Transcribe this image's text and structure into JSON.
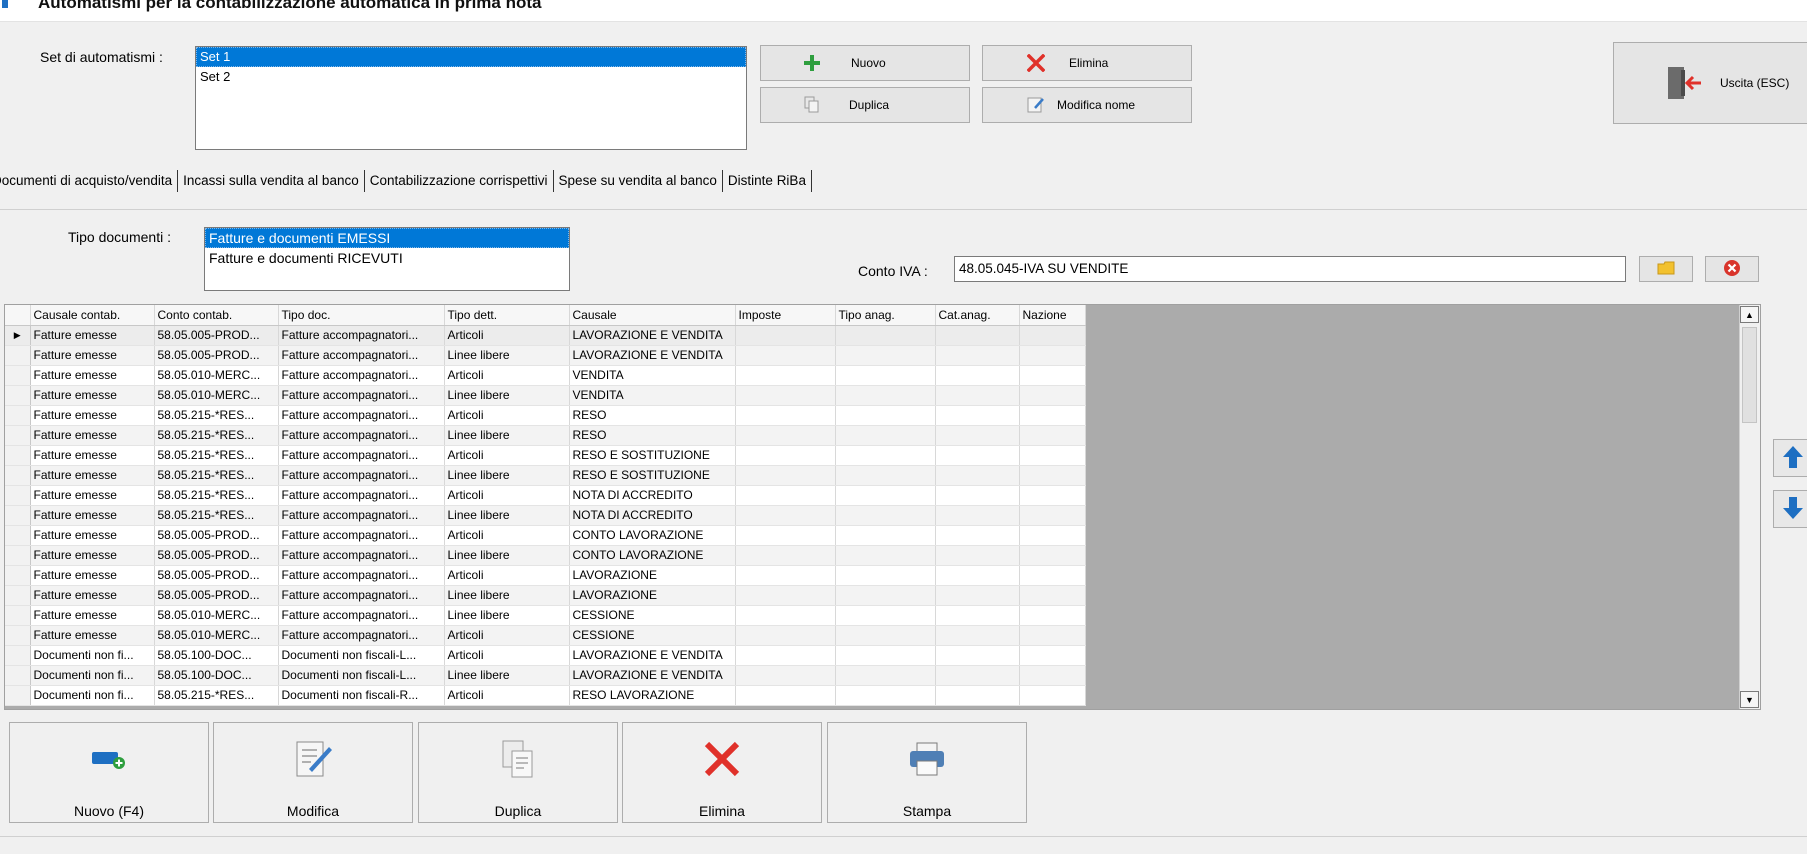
{
  "window": {
    "title": "Automatismi per la contabilizzazione automatica in prima nota"
  },
  "set_label": "Set di automatismi :",
  "sets": [
    "Set 1",
    "Set 2"
  ],
  "toolbar": {
    "nuovo": "Nuovo",
    "elimina": "Elimina",
    "duplica": "Duplica",
    "modifica_nome": "Modifica nome",
    "uscita": "Uscita (ESC)"
  },
  "tabs": [
    "Documenti di acquisto/vendita",
    "Incassi sulla vendita al banco",
    "Contabilizzazione corrispettivi",
    "Spese su vendita al banco",
    "Distinte RiBa"
  ],
  "tipo_documenti_label": "Tipo documenti :",
  "tipo_documenti": [
    "Fatture e documenti EMESSI",
    "Fatture e documenti RICEVUTI"
  ],
  "conto_iva_label": "Conto IVA :",
  "conto_iva_value": "48.05.045-IVA SU VENDITE",
  "grid": {
    "columns": [
      "Causale contab.",
      "Conto contab.",
      "Tipo doc.",
      "Tipo dett.",
      "Causale",
      "Imposte",
      "Tipo anag.",
      "Cat.anag.",
      "Nazione"
    ],
    "current_row_marker": "▶",
    "rows": [
      [
        "Fatture emesse",
        "58.05.005-PROD...",
        "Fatture accompagnatori...",
        "Articoli",
        "LAVORAZIONE E VENDITA",
        "",
        "",
        "",
        ""
      ],
      [
        "Fatture emesse",
        "58.05.005-PROD...",
        "Fatture accompagnatori...",
        "Linee libere",
        "LAVORAZIONE E VENDITA",
        "",
        "",
        "",
        ""
      ],
      [
        "Fatture emesse",
        "58.05.010-MERC...",
        "Fatture accompagnatori...",
        "Articoli",
        "VENDITA",
        "",
        "",
        "",
        ""
      ],
      [
        "Fatture emesse",
        "58.05.010-MERC...",
        "Fatture accompagnatori...",
        "Linee libere",
        "VENDITA",
        "",
        "",
        "",
        ""
      ],
      [
        "Fatture emesse",
        "58.05.215-*RES...",
        "Fatture accompagnatori...",
        "Articoli",
        "RESO",
        "",
        "",
        "",
        ""
      ],
      [
        "Fatture emesse",
        "58.05.215-*RES...",
        "Fatture accompagnatori...",
        "Linee libere",
        "RESO",
        "",
        "",
        "",
        ""
      ],
      [
        "Fatture emesse",
        "58.05.215-*RES...",
        "Fatture accompagnatori...",
        "Articoli",
        "RESO E SOSTITUZIONE",
        "",
        "",
        "",
        ""
      ],
      [
        "Fatture emesse",
        "58.05.215-*RES...",
        "Fatture accompagnatori...",
        "Linee libere",
        "RESO E SOSTITUZIONE",
        "",
        "",
        "",
        ""
      ],
      [
        "Fatture emesse",
        "58.05.215-*RES...",
        "Fatture accompagnatori...",
        "Articoli",
        "NOTA DI ACCREDITO",
        "",
        "",
        "",
        ""
      ],
      [
        "Fatture emesse",
        "58.05.215-*RES...",
        "Fatture accompagnatori...",
        "Linee libere",
        "NOTA DI ACCREDITO",
        "",
        "",
        "",
        ""
      ],
      [
        "Fatture emesse",
        "58.05.005-PROD...",
        "Fatture accompagnatori...",
        "Articoli",
        "CONTO LAVORAZIONE",
        "",
        "",
        "",
        ""
      ],
      [
        "Fatture emesse",
        "58.05.005-PROD...",
        "Fatture accompagnatori...",
        "Linee libere",
        "CONTO LAVORAZIONE",
        "",
        "",
        "",
        ""
      ],
      [
        "Fatture emesse",
        "58.05.005-PROD...",
        "Fatture accompagnatori...",
        "Articoli",
        "LAVORAZIONE",
        "",
        "",
        "",
        ""
      ],
      [
        "Fatture emesse",
        "58.05.005-PROD...",
        "Fatture accompagnatori...",
        "Linee libere",
        "LAVORAZIONE",
        "",
        "",
        "",
        ""
      ],
      [
        "Fatture emesse",
        "58.05.010-MERC...",
        "Fatture accompagnatori...",
        "Linee libere",
        "CESSIONE",
        "",
        "",
        "",
        ""
      ],
      [
        "Fatture emesse",
        "58.05.010-MERC...",
        "Fatture accompagnatori...",
        "Articoli",
        "CESSIONE",
        "",
        "",
        "",
        ""
      ],
      [
        "Documenti non fi...",
        "58.05.100-DOC...",
        "Documenti non fiscali-L...",
        "Articoli",
        "LAVORAZIONE E VENDITA",
        "",
        "",
        "",
        ""
      ],
      [
        "Documenti non fi...",
        "58.05.100-DOC...",
        "Documenti non fiscali-L...",
        "Linee libere",
        "LAVORAZIONE E VENDITA",
        "",
        "",
        "",
        ""
      ],
      [
        "Documenti non fi...",
        "58.05.215-*RES...",
        "Documenti non fiscali-R...",
        "Articoli",
        "RESO LAVORAZIONE",
        "",
        "",
        "",
        ""
      ]
    ]
  },
  "bottom_buttons": {
    "nuovo": "Nuovo (F4)",
    "modifica": "Modifica",
    "duplica": "Duplica",
    "elimina": "Elimina",
    "stampa": "Stampa"
  },
  "colors": {
    "selection": "#0078d7",
    "add_green": "#2e9e3e",
    "delete_red": "#e0312a",
    "arrow_blue": "#1e6fc2"
  }
}
